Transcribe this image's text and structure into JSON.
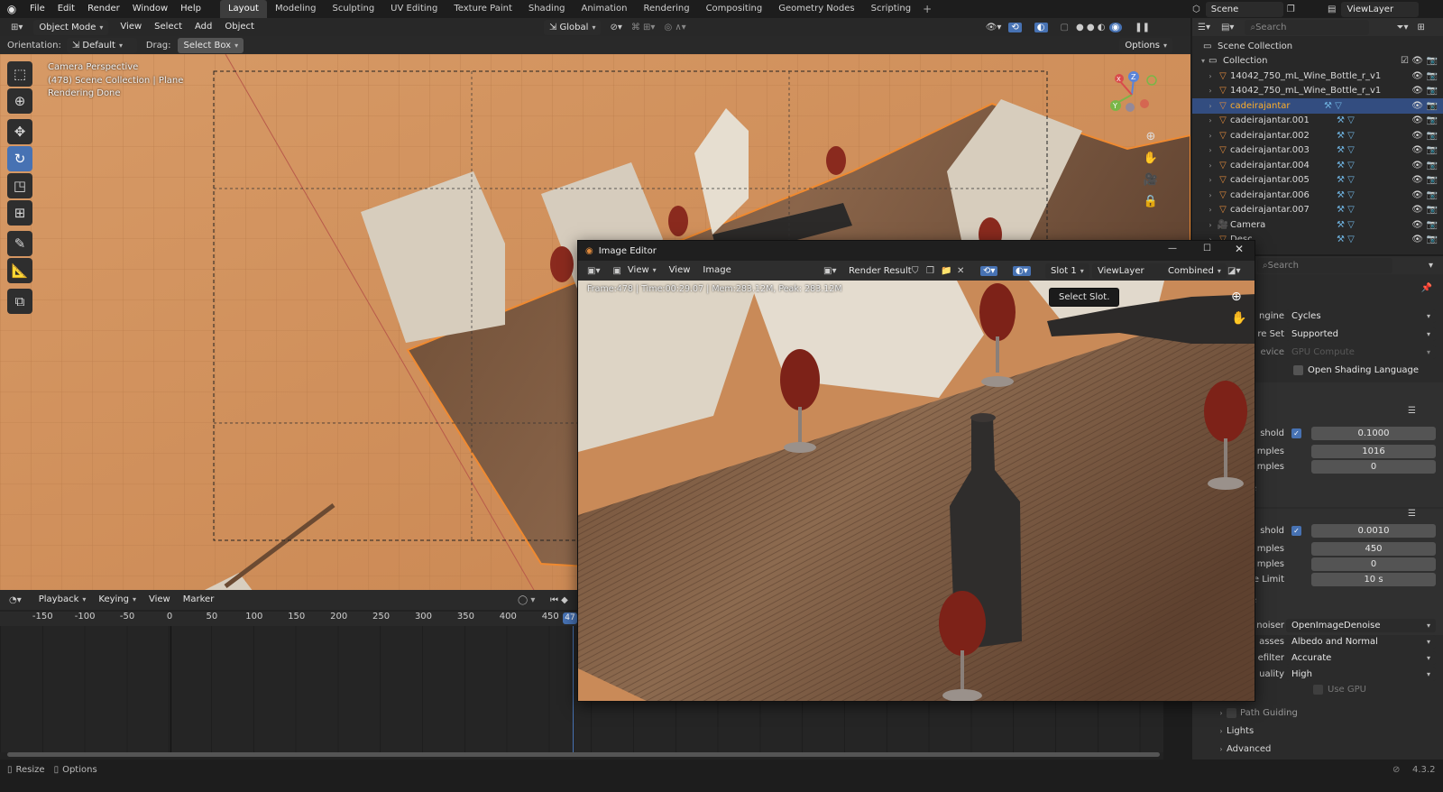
{
  "topbar": {
    "menus": [
      "File",
      "Edit",
      "Render",
      "Window",
      "Help"
    ],
    "workspaces": [
      "Layout",
      "Modeling",
      "Sculpting",
      "UV Editing",
      "Texture Paint",
      "Shading",
      "Animation",
      "Rendering",
      "Compositing",
      "Geometry Nodes",
      "Scripting"
    ],
    "active_workspace": "Layout",
    "scene": "Scene",
    "view_layer": "ViewLayer"
  },
  "viewport_header": {
    "mode": "Object Mode",
    "menus": [
      "View",
      "Select",
      "Add",
      "Object"
    ],
    "transform": "Global",
    "orientation_label": "Orientation:",
    "orientation_value": "Default",
    "drag_label": "Drag:",
    "drag_value": "Select Box",
    "options": "Options"
  },
  "viewport_overlay": {
    "line1": "Camera Perspective",
    "line2": "(478) Scene Collection | Plane",
    "line3": "Rendering Done"
  },
  "timeline": {
    "menus": [
      "Playback",
      "Keying",
      "View",
      "Marker"
    ],
    "ticks": [
      "-150",
      "-100",
      "-50",
      "0",
      "50",
      "100",
      "150",
      "200",
      "250",
      "300",
      "350",
      "400",
      "450"
    ],
    "current_frame": "47"
  },
  "statusbar": {
    "left1": "Resize",
    "left2": "Options",
    "version": "4.3.2"
  },
  "outliner": {
    "search_placeholder": "Search",
    "scene_collection": "Scene Collection",
    "collection": "Collection",
    "items": [
      {
        "name": "14042_750_mL_Wine_Bottle_r_v1",
        "selected": false
      },
      {
        "name": "14042_750_mL_Wine_Bottle_r_v1",
        "selected": false
      },
      {
        "name": "cadeirajantar",
        "selected": true
      },
      {
        "name": "cadeirajantar.001",
        "selected": false
      },
      {
        "name": "cadeirajantar.002",
        "selected": false
      },
      {
        "name": "cadeirajantar.003",
        "selected": false
      },
      {
        "name": "cadeirajantar.004",
        "selected": false
      },
      {
        "name": "cadeirajantar.005",
        "selected": false
      },
      {
        "name": "cadeirajantar.006",
        "selected": false
      },
      {
        "name": "cadeirajantar.007",
        "selected": false
      },
      {
        "name": "Camera",
        "selected": false
      },
      {
        "name": "Desc",
        "selected": false
      }
    ]
  },
  "properties": {
    "search_placeholder": "Search",
    "rows": [
      {
        "label": "ngine",
        "value": "Cycles",
        "kind": "dropdown"
      },
      {
        "label": "re Set",
        "value": "Supported",
        "kind": "dropdown"
      },
      {
        "label": "evice",
        "value": "GPU Compute",
        "kind": "dropdown-disabled"
      },
      {
        "label": "",
        "value": "Open Shading Language",
        "kind": "checkbox-off"
      }
    ],
    "noise1": {
      "threshold_label": "shold",
      "threshold": "0.1000",
      "max_label": "mples",
      "max": "1016",
      "min_label": "mples",
      "min": "0",
      "section": "se"
    },
    "noise2": {
      "threshold_label": "shold",
      "threshold": "0.0010",
      "max_label": "mples",
      "max": "450",
      "min_label": "mples",
      "min": "0",
      "time_label": "e Limit",
      "time": "10 s",
      "section": "se"
    },
    "denoise": [
      {
        "label": "noiser",
        "value": "OpenImageDenoise"
      },
      {
        "label": "asses",
        "value": "Albedo and Normal"
      },
      {
        "label": "efilter",
        "value": "Accurate"
      },
      {
        "label": "uality",
        "value": "High"
      }
    ],
    "use_gpu": "Use GPU",
    "sections": [
      "Path Guiding",
      "Lights",
      "Advanced"
    ]
  },
  "image_editor": {
    "title": "Image Editor",
    "menus": [
      "View",
      "View",
      "Image"
    ],
    "image_name": "Render Result",
    "slot": "Slot 1",
    "layer": "ViewLayer",
    "pass": "Combined",
    "info": "Frame:478 | Time:00:29.07 | Mem:283.12M, Peak: 283.12M",
    "tooltip": "Select Slot."
  },
  "colors": {
    "accent": "#4772b3",
    "selection_orange": "#f08a30",
    "floor": "#c98a58"
  }
}
